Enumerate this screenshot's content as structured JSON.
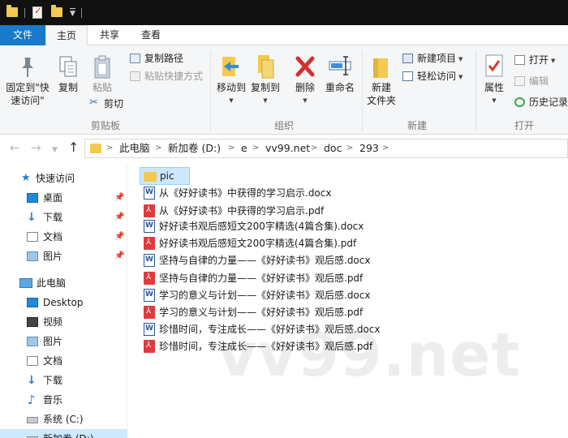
{
  "ribbon_tabs": {
    "file": "文件",
    "home": "主页",
    "share": "共享",
    "view": "查看"
  },
  "ribbon": {
    "pin_label_1": "固定到\"快",
    "pin_label_2": "速访问\"",
    "copy": "复制",
    "paste": "粘贴",
    "copy_path": "复制路径",
    "paste_shortcut": "粘贴快捷方式",
    "cut": "剪切",
    "clipboard_group": "剪贴板",
    "move_to": "移动到",
    "copy_to": "复制到",
    "delete": "删除",
    "rename": "重命名",
    "organize_group": "组织",
    "new_folder_1": "新建",
    "new_folder_2": "文件夹",
    "new_item": "新建项目",
    "easy_access": "轻松访问",
    "new_group": "新建",
    "properties": "属性",
    "open": "打开",
    "edit": "编辑",
    "history": "历史记录",
    "open_group": "打开"
  },
  "breadcrumb": [
    "此电脑",
    "新加卷 (D:)",
    "e",
    "vv99.net",
    "doc",
    "293"
  ],
  "nav_pane": {
    "quick_access": "快速访问",
    "quick_items": [
      "桌面",
      "下载",
      "文档",
      "图片"
    ],
    "this_pc": "此电脑",
    "pc_items": [
      "Desktop",
      "视频",
      "图片",
      "文档",
      "下载",
      "音乐",
      "系统 (C:)",
      "新加卷 (D:)"
    ]
  },
  "files": [
    {
      "name": "pic",
      "type": "folder"
    },
    {
      "name": "从《好好读书》中获得的学习启示.docx",
      "type": "word"
    },
    {
      "name": "从《好好读书》中获得的学习启示.pdf",
      "type": "pdf"
    },
    {
      "name": "好好读书观后感短文200字精选(4篇合集).docx",
      "type": "word"
    },
    {
      "name": "好好读书观后感短文200字精选(4篇合集).pdf",
      "type": "pdf"
    },
    {
      "name": "坚持与自律的力量——《好好读书》观后感.docx",
      "type": "word"
    },
    {
      "name": "坚持与自律的力量——《好好读书》观后感.pdf",
      "type": "pdf"
    },
    {
      "name": "学习的意义与计划——《好好读书》观后感.docx",
      "type": "word"
    },
    {
      "name": "学习的意义与计划——《好好读书》观后感.pdf",
      "type": "pdf"
    },
    {
      "name": "珍惜时间，专注成长——《好好读书》观后感.docx",
      "type": "word"
    },
    {
      "name": "珍惜时间，专注成长——《好好读书》观后感.pdf",
      "type": "pdf"
    }
  ],
  "watermark": "vv99.net"
}
